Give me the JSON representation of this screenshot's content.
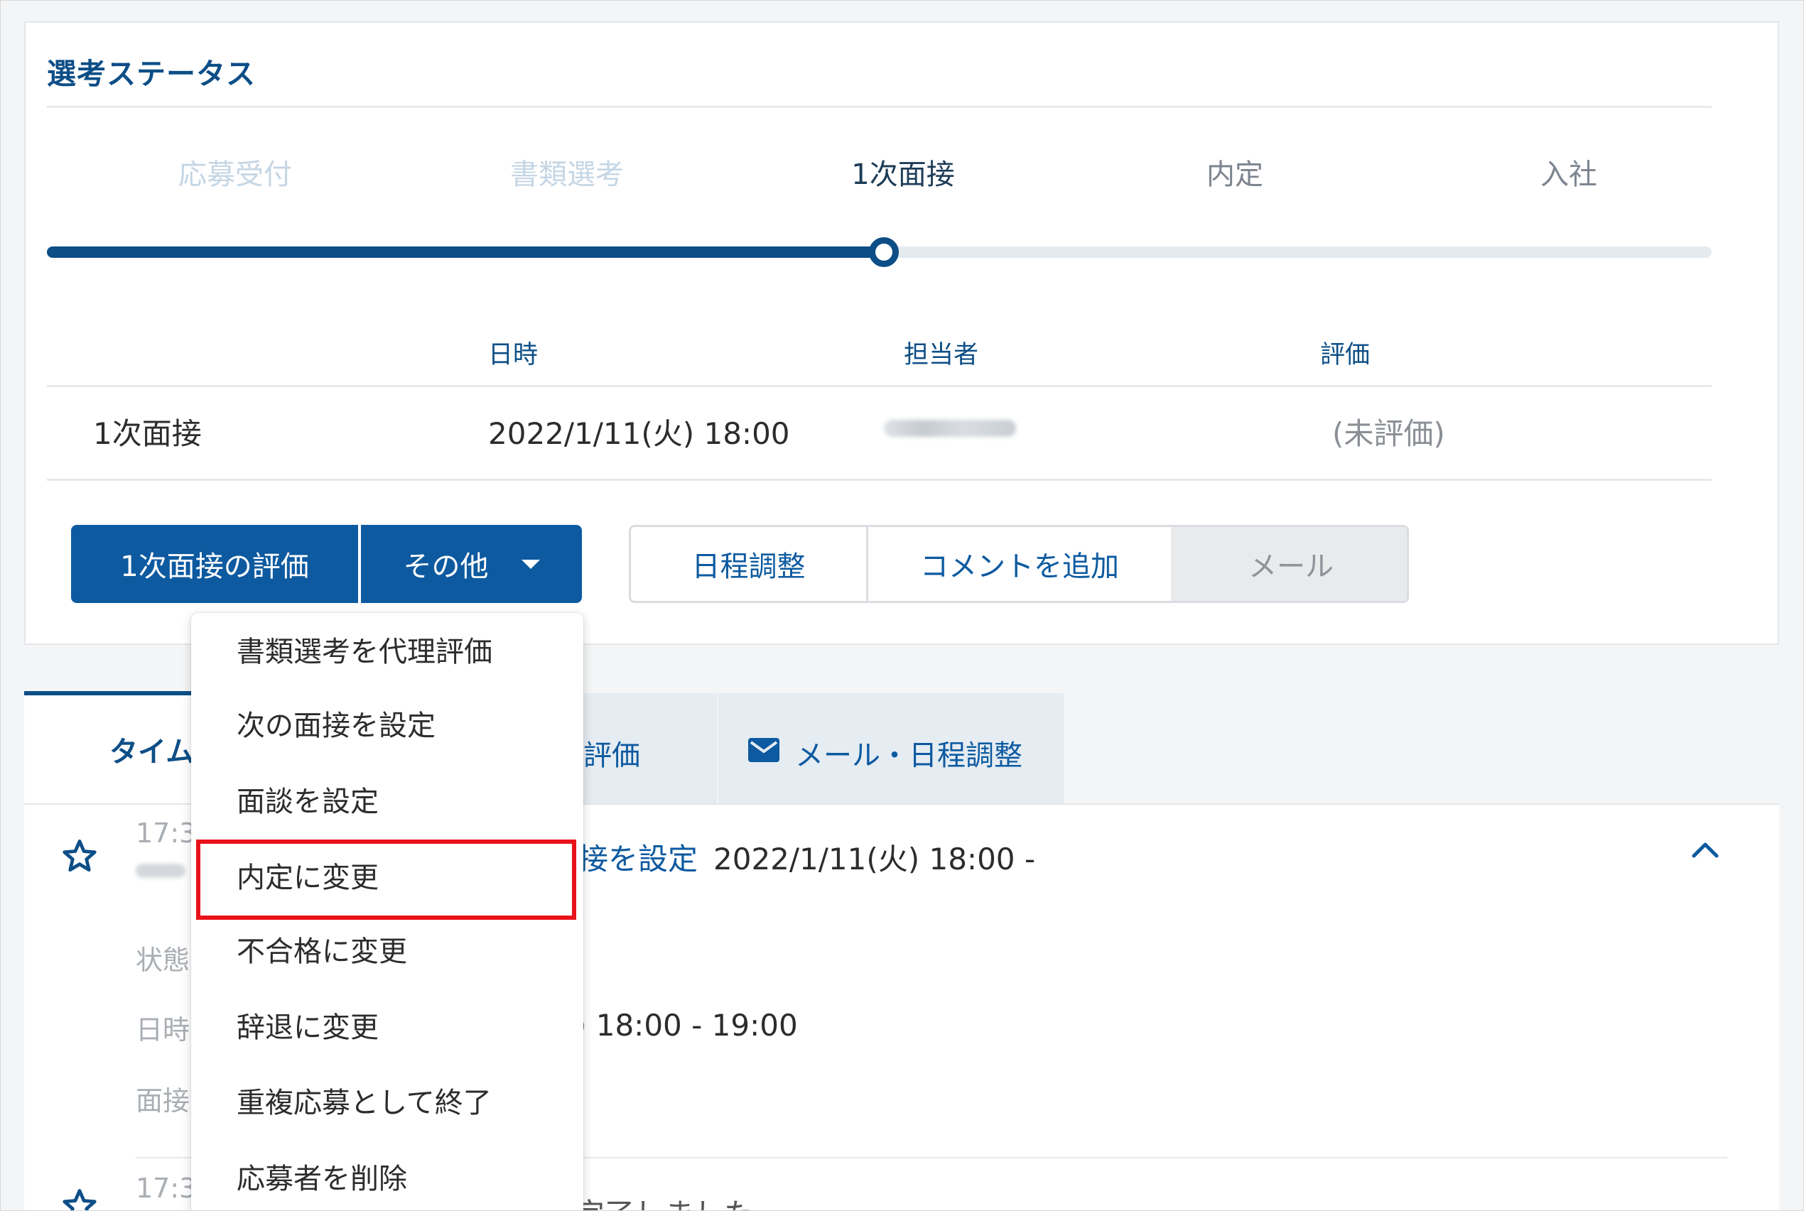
{
  "status_card": {
    "title": "選考ステータス",
    "steps": [
      {
        "label": "応募受付",
        "state": "done"
      },
      {
        "label": "書類選考",
        "state": "done"
      },
      {
        "label": "1次面接",
        "state": "current"
      },
      {
        "label": "内定",
        "state": "future"
      },
      {
        "label": "入社",
        "state": "future"
      }
    ],
    "progress": {
      "current_step_index": 2,
      "total_steps": 5
    },
    "table": {
      "headers": {
        "datetime": "日時",
        "assignee": "担当者",
        "evaluation": "評価"
      },
      "row": {
        "stage": "1次面接",
        "datetime": "2022/1/11(火) 18:00",
        "evaluation": "(未評価)"
      }
    },
    "buttons": {
      "evaluate": "1次面接の評価",
      "other": "その他",
      "schedule": "日程調整",
      "add_comment": "コメントを追加",
      "mail": "メール"
    }
  },
  "tabs": {
    "timeline_partial": "タイム",
    "evaluation_partial": "評価",
    "mail_schedule": "メール・日程調整"
  },
  "timeline": {
    "event1": {
      "time_partial": "17:3",
      "link_partial": "接を設定",
      "date_text": "2022/1/11(火) 18:00 -"
    },
    "fields": {
      "status_partial": "状態",
      "datetime_partial": "日時",
      "interviewer_partial": "面接",
      "datetime_value_partial": ") 18:00 - 19:00"
    },
    "event2": {
      "time_partial": "17:3",
      "text_partial": "完了しました"
    }
  },
  "dropdown": {
    "items": [
      "書類選考を代理評価",
      "次の面接を設定",
      "面談を設定",
      "内定に変更",
      "不合格に変更",
      "辞退に変更",
      "重複応募として終了",
      "応募者を削除"
    ],
    "highlighted_index": 3
  },
  "colors": {
    "primary": "#0d5aa0",
    "title": "#0d4e86",
    "highlight": "#e8121a"
  },
  "icons": [
    "star-icon",
    "mail-icon",
    "chevron-up-icon",
    "caret-down-icon"
  ]
}
